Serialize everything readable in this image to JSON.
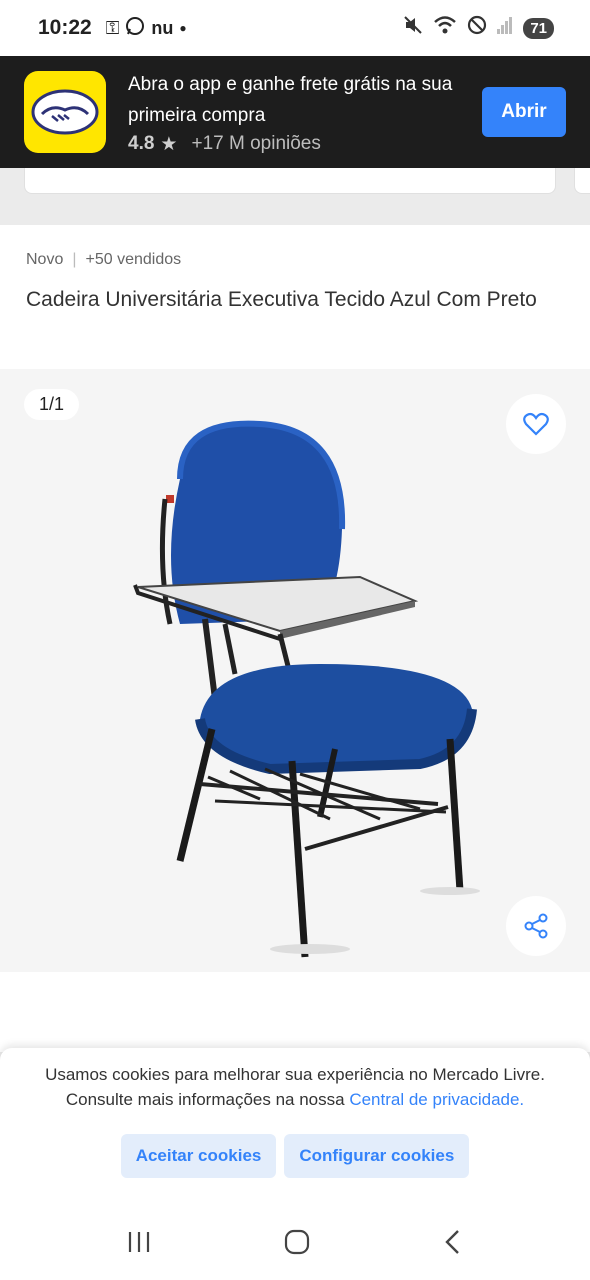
{
  "status_bar": {
    "time": "10:22",
    "left_icons": [
      "key-icon",
      "whatsapp-icon",
      "nu-icon",
      "dot"
    ],
    "nu_label": "nu",
    "battery": "71"
  },
  "app_banner": {
    "title": "Abra o app e ganhe frete grátis na sua primeira compra",
    "rating": "4.8",
    "opinions": "+17 M opiniões",
    "open_label": "Abrir",
    "brand_color": "#ffe600",
    "button_color": "#3483fa"
  },
  "product": {
    "condition": "Novo",
    "sold": "+50 vendidos",
    "title": "Cadeira Universitária Executiva Tecido Azul Com Preto"
  },
  "gallery": {
    "counter": "1/1",
    "image": "blue-university-chair-image"
  },
  "cookie_banner": {
    "text": "Usamos cookies para melhorar sua experiência no Mercado Livre. Consulte mais informações na nossa ",
    "link": "Central de privacidade.",
    "accept_label": "Aceitar cookies",
    "configure_label": "Configurar cookies"
  },
  "nav_bar": {
    "icons": [
      "recent-apps-icon",
      "home-icon",
      "back-icon"
    ]
  }
}
